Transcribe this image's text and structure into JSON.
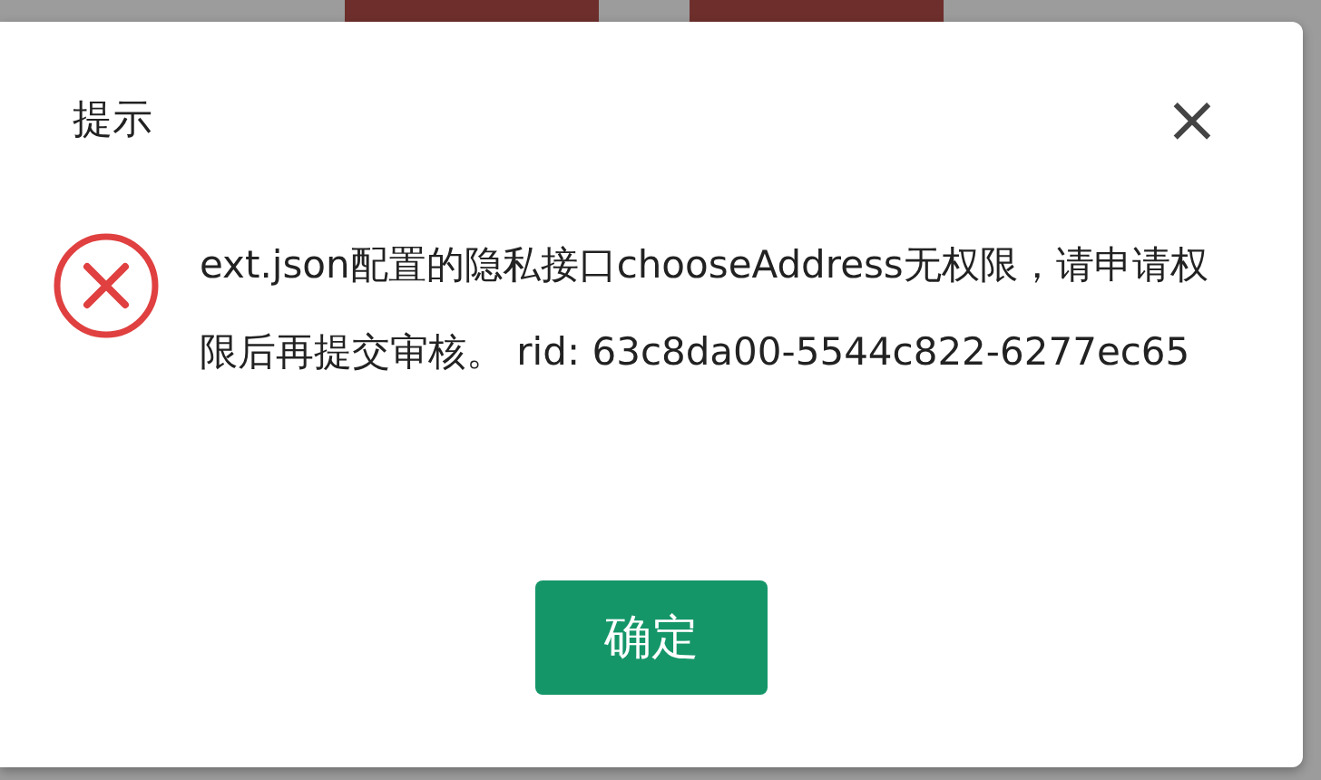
{
  "dialog": {
    "title": "提示",
    "close": "×",
    "message": "ext.json配置的隐私接口chooseAddress无权限，请申请权限后再提交审核。 rid: 63c8da00-5544c822-6277ec65",
    "icon": {
      "kind": "error"
    },
    "buttons": [
      "确定"
    ]
  }
}
